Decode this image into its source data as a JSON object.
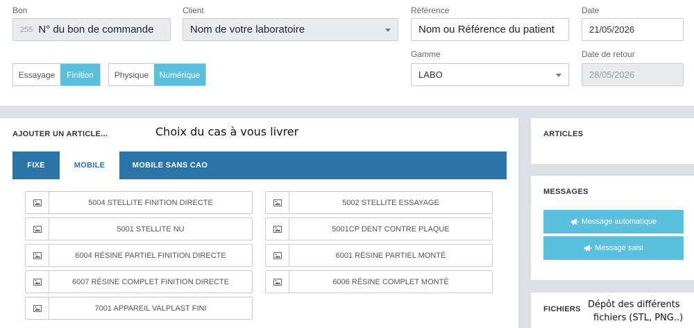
{
  "header": {
    "bon": {
      "label": "Bon",
      "number": "255",
      "value": "N° du bon de commande"
    },
    "client": {
      "label": "Client",
      "value": "Nom de votre laboratoire"
    },
    "reference": {
      "label": "Référence",
      "value": "Nom ou Référence du patient"
    },
    "date": {
      "label": "Date",
      "value": "21/05/2026"
    },
    "gamme": {
      "label": "Gamme",
      "value": "LABO"
    },
    "date_retour": {
      "label": "Date de retour",
      "value": "28/05/2026"
    },
    "stage_toggle": {
      "option1": "Essayage",
      "option2": "Finition",
      "selected": "Finition"
    },
    "type_toggle": {
      "option1": "Physique",
      "option2": "Numérique",
      "selected": "Numérique"
    }
  },
  "add_article": {
    "title": "AJOUTER UN ARTICLE...",
    "annotation": "Choix du cas à vous livrer",
    "tabs": [
      {
        "label": "FIXE"
      },
      {
        "label": "MOBILE"
      },
      {
        "label": "MOBILE SANS CAO"
      }
    ],
    "active_tab": "MOBILE",
    "items": [
      {
        "label": "5004 STELLITE FINITION DIRECTE"
      },
      {
        "label": "5002 STELLITE ESSAYAGE"
      },
      {
        "label": "5001 STELLITE NU"
      },
      {
        "label": "5001CP DENT CONTRE PLAQUE"
      },
      {
        "label": "6004 RÉSINE PARTIEL FINITION DIRECTE"
      },
      {
        "label": "6001 RÉSINE PARTIEL MONTÉ"
      },
      {
        "label": "6007 RÉSINE COMPLET FINITION DIRECTE"
      },
      {
        "label": "6006 RÉSINE COMPLET MONTÉ"
      },
      {
        "label": "7001 APPAREIL VALPLAST FINI"
      }
    ]
  },
  "sidebar": {
    "articles_title": "ARTICLES",
    "messages_title": "MESSAGES",
    "msg_auto": "Message automatique",
    "msg_saisi": "Message saisi",
    "fichiers_title": "FICHIERS",
    "fichiers_annotation_line1": "Dépôt des différents",
    "fichiers_annotation_line2": "fichiers (STL, PNG..)"
  },
  "colors": {
    "accent": "#5bc0de",
    "tabs": "#2a74a8",
    "band": "#dde1e7"
  }
}
